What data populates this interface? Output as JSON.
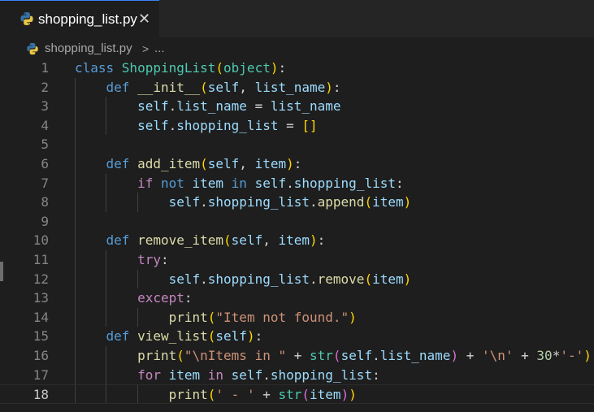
{
  "tab": {
    "label": "shopping_list.py",
    "close_icon": "close-icon",
    "file_icon": "python-icon"
  },
  "breadcrumb": {
    "file": "shopping_list.py",
    "separator": ">",
    "more": "..."
  },
  "editor": {
    "current_line": 18,
    "lines": [
      {
        "n": "1",
        "tokens": [
          [
            "class ",
            "keyword"
          ],
          [
            "ShoppingList",
            "class"
          ],
          [
            "(",
            "bracket1"
          ],
          [
            "object",
            "class"
          ],
          [
            ")",
            "bracket1"
          ],
          [
            ":",
            "plain"
          ]
        ]
      },
      {
        "n": "2",
        "tokens": [
          [
            "    ",
            "plain"
          ],
          [
            "def ",
            "keyword"
          ],
          [
            "__init__",
            "function"
          ],
          [
            "(",
            "bracket1"
          ],
          [
            "self",
            "variable"
          ],
          [
            ", ",
            "plain"
          ],
          [
            "list_name",
            "variable"
          ],
          [
            ")",
            "bracket1"
          ],
          [
            ":",
            "plain"
          ]
        ]
      },
      {
        "n": "3",
        "tokens": [
          [
            "        ",
            "plain"
          ],
          [
            "self",
            "variable"
          ],
          [
            ".",
            "plain"
          ],
          [
            "list_name",
            "variable"
          ],
          [
            " = ",
            "plain"
          ],
          [
            "list_name",
            "variable"
          ]
        ]
      },
      {
        "n": "4",
        "tokens": [
          [
            "        ",
            "plain"
          ],
          [
            "self",
            "variable"
          ],
          [
            ".",
            "plain"
          ],
          [
            "shopping_list",
            "variable"
          ],
          [
            " = ",
            "plain"
          ],
          [
            "[]",
            "bracket1"
          ]
        ]
      },
      {
        "n": "5",
        "tokens": []
      },
      {
        "n": "6",
        "tokens": [
          [
            "    ",
            "plain"
          ],
          [
            "def ",
            "keyword"
          ],
          [
            "add_item",
            "function"
          ],
          [
            "(",
            "bracket1"
          ],
          [
            "self",
            "variable"
          ],
          [
            ", ",
            "plain"
          ],
          [
            "item",
            "variable"
          ],
          [
            ")",
            "bracket1"
          ],
          [
            ":",
            "plain"
          ]
        ]
      },
      {
        "n": "7",
        "tokens": [
          [
            "        ",
            "plain"
          ],
          [
            "if ",
            "control"
          ],
          [
            "not ",
            "keyword"
          ],
          [
            "item ",
            "variable"
          ],
          [
            "in ",
            "keyword"
          ],
          [
            "self",
            "variable"
          ],
          [
            ".",
            "plain"
          ],
          [
            "shopping_list",
            "variable"
          ],
          [
            ":",
            "plain"
          ]
        ]
      },
      {
        "n": "8",
        "tokens": [
          [
            "            ",
            "plain"
          ],
          [
            "self",
            "variable"
          ],
          [
            ".",
            "plain"
          ],
          [
            "shopping_list",
            "variable"
          ],
          [
            ".",
            "plain"
          ],
          [
            "append",
            "function"
          ],
          [
            "(",
            "bracket1"
          ],
          [
            "item",
            "variable"
          ],
          [
            ")",
            "bracket1"
          ]
        ]
      },
      {
        "n": "9",
        "tokens": []
      },
      {
        "n": "10",
        "tokens": [
          [
            "    ",
            "plain"
          ],
          [
            "def ",
            "keyword"
          ],
          [
            "remove_item",
            "function"
          ],
          [
            "(",
            "bracket1"
          ],
          [
            "self",
            "variable"
          ],
          [
            ", ",
            "plain"
          ],
          [
            "item",
            "variable"
          ],
          [
            ")",
            "bracket1"
          ],
          [
            ":",
            "plain"
          ]
        ]
      },
      {
        "n": "11",
        "tokens": [
          [
            "        ",
            "plain"
          ],
          [
            "try",
            "control"
          ],
          [
            ":",
            "plain"
          ]
        ]
      },
      {
        "n": "12",
        "tokens": [
          [
            "            ",
            "plain"
          ],
          [
            "self",
            "variable"
          ],
          [
            ".",
            "plain"
          ],
          [
            "shopping_list",
            "variable"
          ],
          [
            ".",
            "plain"
          ],
          [
            "remove",
            "function"
          ],
          [
            "(",
            "bracket1"
          ],
          [
            "item",
            "variable"
          ],
          [
            ")",
            "bracket1"
          ]
        ]
      },
      {
        "n": "13",
        "tokens": [
          [
            "        ",
            "plain"
          ],
          [
            "except",
            "control"
          ],
          [
            ":",
            "plain"
          ]
        ]
      },
      {
        "n": "14",
        "tokens": [
          [
            "            ",
            "plain"
          ],
          [
            "print",
            "function"
          ],
          [
            "(",
            "bracket1"
          ],
          [
            "\"Item not found.\"",
            "string"
          ],
          [
            ")",
            "bracket1"
          ]
        ]
      },
      {
        "n": "15",
        "tokens": [
          [
            "    ",
            "plain"
          ],
          [
            "def ",
            "keyword"
          ],
          [
            "view_list",
            "function"
          ],
          [
            "(",
            "bracket1"
          ],
          [
            "self",
            "variable"
          ],
          [
            ")",
            "bracket1"
          ],
          [
            ":",
            "plain"
          ]
        ]
      },
      {
        "n": "16",
        "tokens": [
          [
            "        ",
            "plain"
          ],
          [
            "print",
            "function"
          ],
          [
            "(",
            "bracket1"
          ],
          [
            "\"\\nItems in \"",
            "string"
          ],
          [
            " + ",
            "plain"
          ],
          [
            "str",
            "class"
          ],
          [
            "(",
            "bracket2"
          ],
          [
            "self",
            "variable"
          ],
          [
            ".",
            "plain"
          ],
          [
            "list_name",
            "variable"
          ],
          [
            ")",
            "bracket2"
          ],
          [
            " + ",
            "plain"
          ],
          [
            "'\\n'",
            "string"
          ],
          [
            " + ",
            "plain"
          ],
          [
            "30",
            "number"
          ],
          [
            "*",
            "plain"
          ],
          [
            "'-'",
            "string"
          ],
          [
            ")",
            "bracket1"
          ]
        ]
      },
      {
        "n": "17",
        "tokens": [
          [
            "        ",
            "plain"
          ],
          [
            "for ",
            "control"
          ],
          [
            "item ",
            "variable"
          ],
          [
            "in ",
            "control"
          ],
          [
            "self",
            "variable"
          ],
          [
            ".",
            "plain"
          ],
          [
            "shopping_list",
            "variable"
          ],
          [
            ":",
            "plain"
          ]
        ]
      },
      {
        "n": "18",
        "tokens": [
          [
            "            ",
            "plain"
          ],
          [
            "print",
            "function"
          ],
          [
            "(",
            "bracket1"
          ],
          [
            "' - '",
            "string"
          ],
          [
            " + ",
            "plain"
          ],
          [
            "str",
            "class"
          ],
          [
            "(",
            "bracket2"
          ],
          [
            "item",
            "variable"
          ],
          [
            ")",
            "bracket2"
          ],
          [
            ")",
            "bracket1"
          ]
        ]
      }
    ]
  }
}
